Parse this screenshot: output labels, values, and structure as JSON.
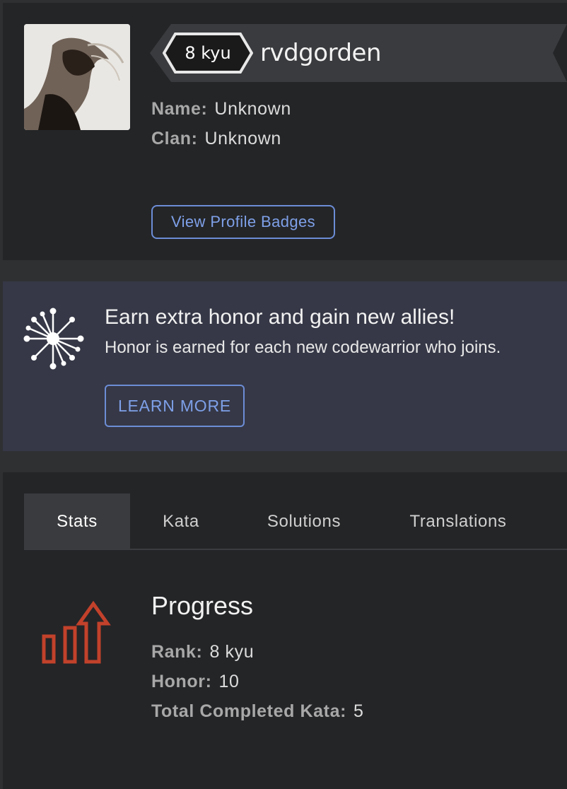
{
  "profile": {
    "rank": "8 kyu",
    "username": "rvdgorden",
    "name_label": "Name:",
    "name_value": "Unknown",
    "clan_label": "Clan:",
    "clan_value": "Unknown",
    "badges_button": "View Profile Badges"
  },
  "promo": {
    "icon": "network-allies-icon",
    "title": "Earn extra honor and gain new allies!",
    "text": "Honor is earned for each new codewarrior who joins.",
    "button": "LEARN MORE"
  },
  "tabs": [
    {
      "label": "Stats",
      "active": true
    },
    {
      "label": "Kata",
      "active": false
    },
    {
      "label": "Solutions",
      "active": false
    },
    {
      "label": "Translations",
      "active": false
    }
  ],
  "progress": {
    "icon": "progress-chart-icon",
    "title": "Progress",
    "rank_label": "Rank:",
    "rank_value": "8 kyu",
    "honor_label": "Honor:",
    "honor_value": "10",
    "kata_label": "Total Completed Kata:",
    "kata_value": "5"
  },
  "colors": {
    "panel": "#242527",
    "promo_bg": "#363847",
    "accent_blue": "#6c8dd6",
    "progress_icon": "#c2412b"
  }
}
